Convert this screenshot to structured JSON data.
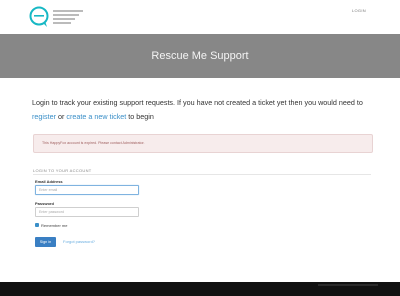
{
  "header": {
    "login_label": "LOGIN",
    "logo_icon": "speech-bubble-logo-icon",
    "brand_color": "#17b8c4"
  },
  "banner": {
    "title": "Rescue Me Support",
    "background": "#878787"
  },
  "intro": {
    "text_before": "Login to track your existing support requests. If you have not created a ticket yet then you would need to ",
    "register_link": "register",
    "or_text": " or ",
    "new_ticket_link": "create a new ticket",
    "text_after": " to begin"
  },
  "alert": {
    "message": "This HappyFox account is expired. Please contact Administrator."
  },
  "login_form": {
    "section_title": "LOGIN TO YOUR ACCOUNT",
    "email_label": "Email Address",
    "email_placeholder": "Enter email",
    "password_label": "Password",
    "password_placeholder": "Enter password",
    "remember_label": "Remember me",
    "remember_checked": true,
    "signin_label": "Sign in",
    "forgot_label": "Forgot password?"
  }
}
